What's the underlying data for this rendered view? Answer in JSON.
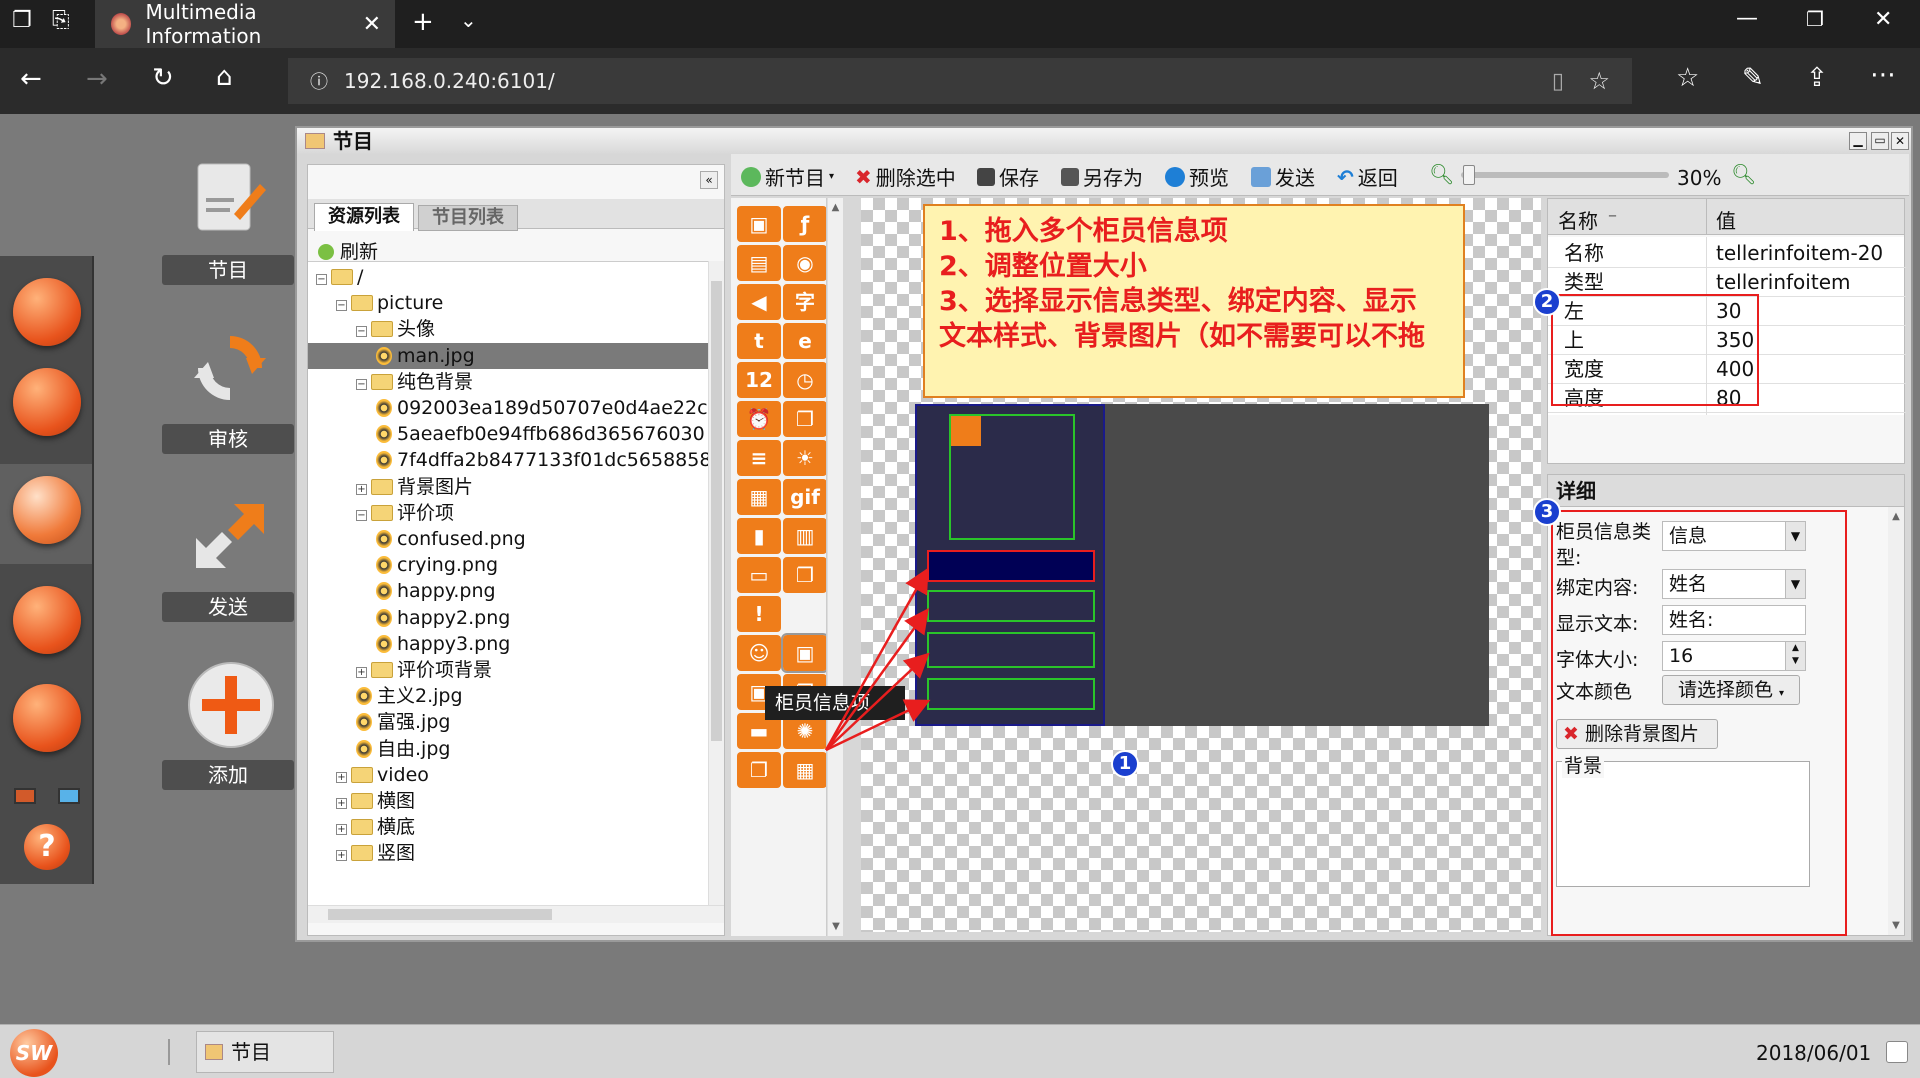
{
  "browser": {
    "tab_title": "Multimedia Information",
    "address": "192.168.0.240:6101/"
  },
  "sidebar": {
    "sections": [
      {
        "label": "节目"
      },
      {
        "label": "审核"
      },
      {
        "label": "发送"
      },
      {
        "label": "添加"
      }
    ]
  },
  "window": {
    "title": "节目",
    "left_tabs": [
      "资源列表",
      "节目列表"
    ],
    "refresh_label": "刷新",
    "tree": [
      {
        "label": "/",
        "indent": 0,
        "kind": "folder",
        "exp": "minus"
      },
      {
        "label": "picture",
        "indent": 1,
        "kind": "folder",
        "exp": "minus"
      },
      {
        "label": "头像",
        "indent": 2,
        "kind": "folder",
        "exp": "minus"
      },
      {
        "label": "man.jpg",
        "indent": 3,
        "kind": "file",
        "selected": true
      },
      {
        "label": "纯色背景",
        "indent": 2,
        "kind": "folder",
        "exp": "minus"
      },
      {
        "label": "092003ea189d50707e0d4ae22c",
        "indent": 3,
        "kind": "file"
      },
      {
        "label": "5aeaefb0e94ffb686d365676030",
        "indent": 3,
        "kind": "file"
      },
      {
        "label": "7f4dffa2b8477133f01dc5658858",
        "indent": 3,
        "kind": "file"
      },
      {
        "label": "背景图片",
        "indent": 2,
        "kind": "folder",
        "exp": "plus"
      },
      {
        "label": "评价项",
        "indent": 2,
        "kind": "folder",
        "exp": "minus"
      },
      {
        "label": "confused.png",
        "indent": 3,
        "kind": "file"
      },
      {
        "label": "crying.png",
        "indent": 3,
        "kind": "file"
      },
      {
        "label": "happy.png",
        "indent": 3,
        "kind": "file"
      },
      {
        "label": "happy2.png",
        "indent": 3,
        "kind": "file"
      },
      {
        "label": "happy3.png",
        "indent": 3,
        "kind": "file"
      },
      {
        "label": "评价项背景",
        "indent": 2,
        "kind": "folder",
        "exp": "plus"
      },
      {
        "label": "主义2.jpg",
        "indent": 2,
        "kind": "file"
      },
      {
        "label": "富强.jpg",
        "indent": 2,
        "kind": "file"
      },
      {
        "label": "自由.jpg",
        "indent": 2,
        "kind": "file"
      },
      {
        "label": "video",
        "indent": 1,
        "kind": "folder",
        "exp": "plus"
      },
      {
        "label": "横图",
        "indent": 1,
        "kind": "folder",
        "exp": "plus"
      },
      {
        "label": "横底",
        "indent": 1,
        "kind": "folder",
        "exp": "plus"
      },
      {
        "label": "竖图",
        "indent": 1,
        "kind": "folder",
        "exp": "plus"
      }
    ],
    "toolbar": {
      "new_program": "新节目",
      "delete_selected": "删除选中",
      "save": "保存",
      "save_as": "另存为",
      "preview": "预览",
      "send": "发送",
      "back": "返回",
      "zoom": "30%",
      "zoom_fraction": 0.3
    },
    "tooltip": "柜员信息项",
    "instructions": [
      "1、拖入多个柜员信息项",
      "2、调整位置大小",
      "3、选择显示信息类型、绑定内容、显示",
      "文本样式、背景图片（如不需要可以不拖"
    ],
    "callouts": [
      "1",
      "2",
      "3"
    ],
    "props": {
      "header_name": "名称",
      "header_value": "值",
      "rows": [
        {
          "k": "名称",
          "v": "tellerinfoitem-20"
        },
        {
          "k": "类型",
          "v": "tellerinfoitem"
        },
        {
          "k": "左",
          "v": "30"
        },
        {
          "k": "上",
          "v": "350"
        },
        {
          "k": "宽度",
          "v": "400"
        },
        {
          "k": "高度",
          "v": "80"
        }
      ]
    },
    "detail": {
      "title": "详细",
      "type_label_1": "柜员信息类",
      "type_label_2": "型:",
      "type_value": "信息",
      "bind_label": "绑定内容:",
      "bind_value": "姓名",
      "text_label": "显示文本:",
      "text_value": "姓名:",
      "font_label": "字体大小:",
      "font_value": "16",
      "color_label": "文本颜色",
      "color_button": "请选择颜色",
      "delete_bg_button": "删除背景图片",
      "bg_label": "背景"
    }
  },
  "taskbar": {
    "logo": "SW",
    "task": "节目",
    "date": "2018/06/01"
  },
  "colors": {
    "accent": "#ef7d1a",
    "callout": "#1a3fcf",
    "highlight": "#e81e1e",
    "note_bg": "#fff3b0"
  }
}
